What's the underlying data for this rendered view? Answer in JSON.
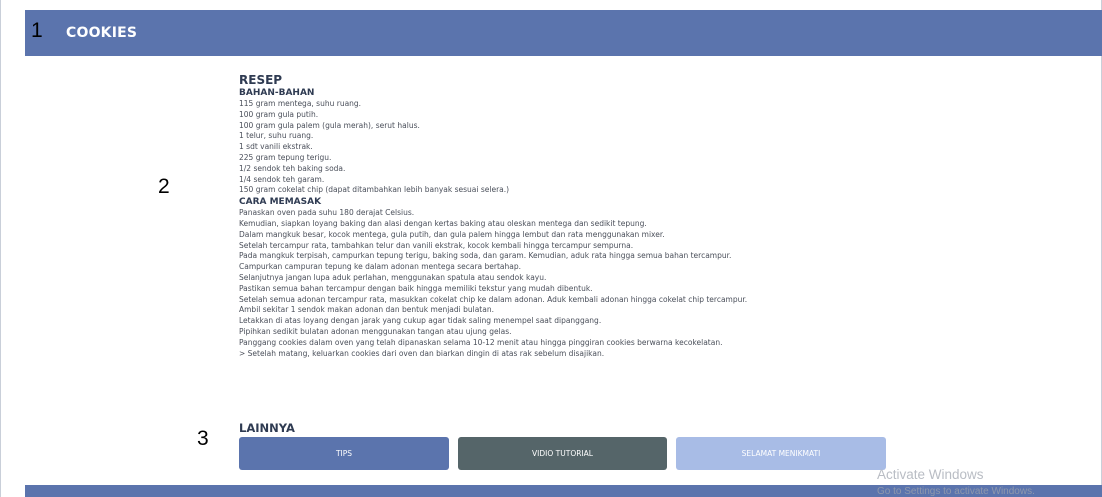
{
  "header": {
    "title": "COOKIES"
  },
  "steps": [
    "1",
    "2",
    "3"
  ],
  "recipe": {
    "title": "RESEP",
    "ingredients_heading": "BAHAN-BAHAN",
    "ingredients": [
      "115 gram mentega, suhu ruang.",
      "100 gram gula putih.",
      "100 gram gula palem (gula merah), serut halus.",
      "1 telur, suhu ruang.",
      "1 sdt vanili ekstrak.",
      "225 gram tepung terigu.",
      "1/2 sendok teh baking soda.",
      "1/4 sendok teh garam.",
      "150 gram cokelat chip (dapat ditambahkan lebih banyak sesuai selera.)"
    ],
    "method_heading": "CARA MEMASAK",
    "method": [
      "Panaskan oven pada suhu 180 derajat Celsius.",
      "Kemudian, siapkan loyang baking dan alasi dengan kertas baking atau oleskan mentega dan sedikit tepung.",
      "Dalam mangkuk besar, kocok mentega, gula putih, dan gula palem hingga lembut dan rata menggunakan mixer.",
      "Setelah tercampur rata, tambahkan telur dan vanili ekstrak, kocok kembali hingga tercampur sempurna.",
      "Pada mangkuk terpisah, campurkan tepung terigu, baking soda, dan garam. Kemudian, aduk rata hingga semua bahan tercampur.",
      "Campurkan campuran tepung ke dalam adonan mentega secara bertahap.",
      "Selanjutnya jangan lupa aduk perlahan, menggunakan spatula atau sendok kayu.",
      "Pastikan semua bahan tercampur dengan baik hingga memiliki tekstur yang mudah dibentuk.",
      "Setelah semua adonan tercampur rata, masukkan cokelat chip ke dalam adonan. Aduk kembali adonan hingga cokelat chip tercampur.",
      "Ambil sekitar 1 sendok makan adonan dan bentuk menjadi bulatan.",
      "Letakkan di atas loyang dengan jarak yang cukup agar tidak saling menempel saat dipanggang.",
      "Pipihkan sedikit bulatan adonan menggunakan tangan atau ujung gelas.",
      "Panggang cookies dalam oven yang telah dipanaskan selama 10-12 menit atau hingga pinggiran cookies berwarna kecokelatan.",
      "> Setelah matang, keluarkan cookies dari oven dan biarkan dingin di atas rak sebelum disajikan."
    ]
  },
  "more": {
    "heading": "LAINNYA",
    "buttons": [
      {
        "label": "TIPS",
        "color": "#5b74ad"
      },
      {
        "label": "VIDIO TUTORIAL",
        "color": "#556569"
      },
      {
        "label": "SELAMAT MENIKMATI",
        "color": "#a8bce6"
      }
    ]
  },
  "windows_watermark": {
    "title": "Activate Windows",
    "subtitle": "Go to Settings to activate Windows."
  },
  "colors": {
    "header_bg": "#5b74ad",
    "heading_text": "#2f3b52",
    "body_text": "#4a4f5a"
  }
}
